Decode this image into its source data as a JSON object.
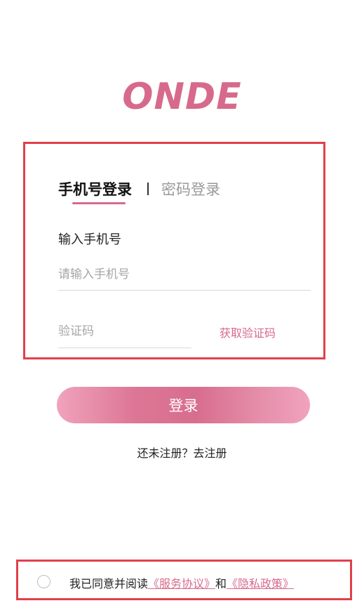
{
  "app": {
    "logo_text": "ONDE"
  },
  "login": {
    "tabs": [
      "手机号登录",
      "密码登录"
    ],
    "phone_label": "输入手机号",
    "phone_placeholder": "请输入手机号",
    "code_placeholder": "验证码",
    "get_code_label": "获取验证码"
  },
  "actions": {
    "login_label": "登录",
    "register_text": "还未注册？去注册"
  },
  "agreement": {
    "prefix": "我已同意并阅读",
    "service_link": "《服务协议》",
    "conjunction": "和",
    "privacy_link": "《隐私政策》",
    "checked": false
  },
  "colors": {
    "accent": "#d76a8c",
    "highlight_border": "#e0404a"
  }
}
